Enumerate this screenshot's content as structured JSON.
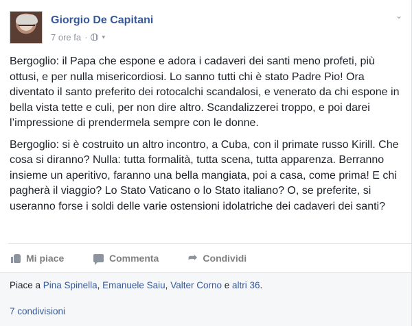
{
  "post": {
    "author": "Giorgio De Capitani",
    "time": "7 ore fa",
    "separator": "·",
    "icons": {
      "privacy": "globe-icon",
      "privacy_caret": "caret-down-icon",
      "menu": "chevron-down-icon"
    },
    "paragraphs": [
      "Bergoglio: il Papa che espone e adora i cadaveri dei santi meno profeti, più ottusi, e per nulla misericordiosi. Lo sanno tutti chi è stato Padre Pio! Ora diventato il santo preferito dei rotocalchi scandalosi, e venerato da chi espone in bella vista tette e culi, per non dire altro. Scandalizzerei troppo, e poi darei l’impressione di prendermela sempre con le donne.",
      "Bergoglio: si è costruito un altro incontro, a Cuba, con il primate russo Kirill. Che cosa si diranno? Nulla: tutta formalità, tutta scena, tutta apparenza. Berranno insieme un aperitivo, faranno una bella mangiata, poi a casa, come prima! E chi pagherà il viaggio? Lo Stato Vaticano o lo Stato italiano? O, se preferite, si useranno forse i soldi delle varie ostensioni idolatriche dei cadaveri dei santi?"
    ]
  },
  "actions": {
    "like": "Mi piace",
    "comment": "Commenta",
    "share": "Condividi"
  },
  "likes": {
    "prefix": "Piace a ",
    "names": [
      "Pina Spinella",
      "Emanuele Saiu",
      "Valter Corno"
    ],
    "sep": ", ",
    "conj": " e ",
    "others": "altri 36",
    "end": "."
  },
  "shares": "7 condivisioni",
  "colors": {
    "link": "#365899",
    "meta": "#90949c",
    "text": "#1d2129"
  }
}
